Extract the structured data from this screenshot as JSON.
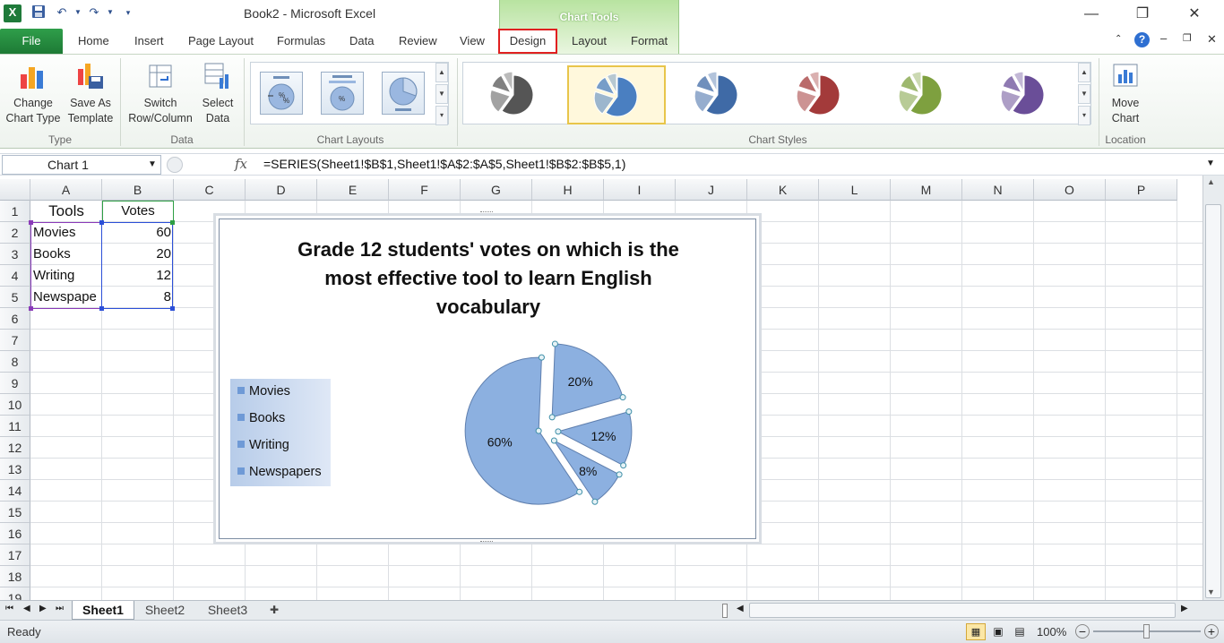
{
  "window": {
    "title": "Book2 - Microsoft Excel",
    "app_icon": "excel-icon"
  },
  "quick_access": {
    "icons": [
      "save-icon",
      "undo-icon",
      "redo-icon",
      "customize-icon"
    ]
  },
  "contextual_tab_group": {
    "label": "Chart Tools",
    "color": "#5cb85c"
  },
  "tabs": {
    "file": "File",
    "items": [
      "Home",
      "Insert",
      "Page Layout",
      "Formulas",
      "Data",
      "Review",
      "View",
      "Design",
      "Layout",
      "Format"
    ],
    "active": "Design"
  },
  "ribbon": {
    "groups": {
      "type": {
        "label": "Type",
        "change_chart_type": "Change\nChart Type",
        "save_as_template": "Save As\nTemplate"
      },
      "data": {
        "label": "Data",
        "switch_row_column": "Switch\nRow/Column",
        "select_data": "Select\nData"
      },
      "chart_layouts": {
        "label": "Chart Layouts"
      },
      "chart_styles": {
        "label": "Chart Styles",
        "colors": [
          "#555555",
          "#4a7fc1",
          "#3f6aa6",
          "#a33a3a",
          "#7ea03f",
          "#6a4e98"
        ],
        "selected_index": 1
      },
      "location": {
        "label": "Location",
        "move_chart": "Move\nChart"
      }
    }
  },
  "formula_bar": {
    "name_box": "Chart 1",
    "fx": "fx",
    "formula": "=SERIES(Sheet1!$B$1,Sheet1!$A$2:$A$5,Sheet1!$B$2:$B$5,1)"
  },
  "grid": {
    "columns": [
      "A",
      "B",
      "C",
      "D",
      "E",
      "F",
      "G",
      "H",
      "I",
      "J",
      "K",
      "L",
      "M",
      "N",
      "O",
      "P"
    ],
    "rows": [
      "1",
      "2",
      "3",
      "4",
      "5",
      "6",
      "7",
      "8",
      "9",
      "10",
      "11",
      "12",
      "13",
      "14",
      "15",
      "16",
      "17",
      "18",
      "19"
    ],
    "cells": {
      "A1": "Tools",
      "B1": "Votes",
      "A2": "Movies",
      "B2": "60",
      "A3": "Books",
      "B3": "20",
      "A4": "Writing",
      "B4": "12",
      "A5": "Newspape",
      "B5": "8"
    }
  },
  "chart_data": {
    "type": "pie",
    "title": "Grade 12 students' votes on which is the most effective tool to learn English vocabulary",
    "title_lines": [
      "Grade 12 students' votes on which is the",
      "most effective tool to learn English",
      "vocabulary"
    ],
    "categories": [
      "Movies",
      "Books",
      "Writing",
      "Newspapers"
    ],
    "values": [
      60,
      20,
      12,
      8
    ],
    "data_labels": [
      "60%",
      "20%",
      "12%",
      "8%"
    ],
    "exploded": true,
    "legend_position": "left",
    "slice_color": "#8cb0e0"
  },
  "sheets": {
    "tabs": [
      "Sheet1",
      "Sheet2",
      "Sheet3"
    ],
    "active": "Sheet1"
  },
  "status": {
    "ready": "Ready",
    "zoom": "100%"
  }
}
